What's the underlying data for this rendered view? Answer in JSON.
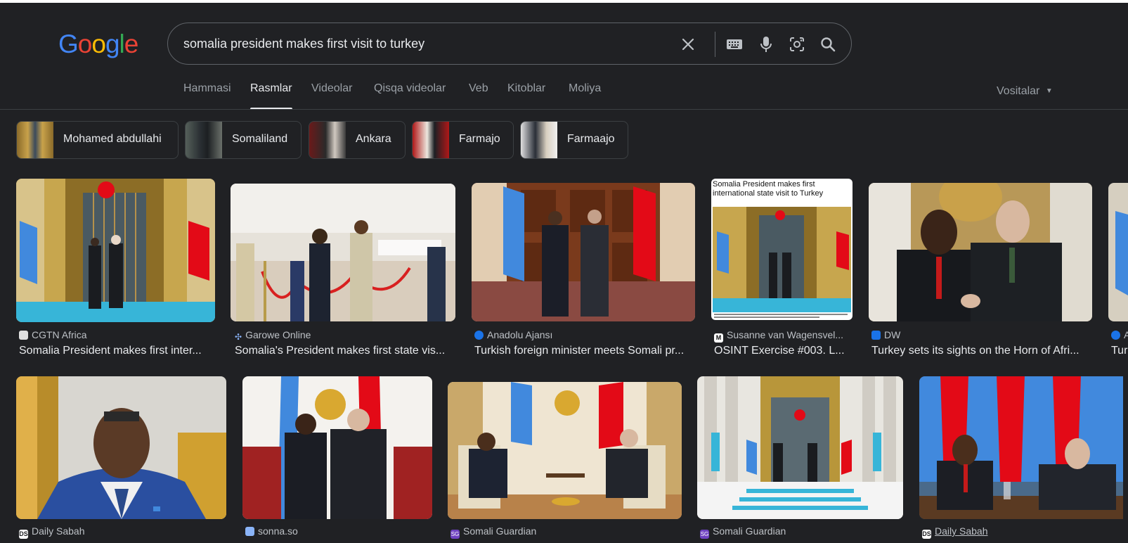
{
  "search": {
    "query": "somalia president makes first visit to turkey"
  },
  "logo": {
    "letters": [
      "G",
      "o",
      "o",
      "g",
      "l",
      "e"
    ],
    "colors": [
      "#4285f4",
      "#ea4335",
      "#fbbc05",
      "#4285f4",
      "#34a853",
      "#ea4335"
    ]
  },
  "icons": {
    "clear": "close-icon",
    "keyboard": "keyboard-icon",
    "voice": "microphone-icon",
    "lens": "camera-icon",
    "search": "search-icon"
  },
  "tabs": [
    {
      "label": "Hammasi"
    },
    {
      "label": "Rasmlar"
    },
    {
      "label": "Videolar"
    },
    {
      "label": "Qisqa videolar"
    },
    {
      "label": "Veb"
    },
    {
      "label": "Kitoblar"
    },
    {
      "label": "Moliya"
    }
  ],
  "active_tab": "Rasmlar",
  "tools_label": "Vositalar",
  "chips": [
    {
      "label": "Mohamed abdullahi"
    },
    {
      "label": "Somaliland"
    },
    {
      "label": "Ankara"
    },
    {
      "label": "Farmajo"
    },
    {
      "label": "Farmaajo"
    }
  ],
  "row1": [
    {
      "source": "CGTN Africa",
      "title": "Somalia President makes first inter..."
    },
    {
      "source": "Garowe Online",
      "title": "Somalia's President makes first state vis..."
    },
    {
      "source": "Anadolu Ajansı",
      "title": "Turkish foreign minister meets Somali pr..."
    },
    {
      "source": "Susanne van Wagensvel...",
      "title": "OSINT Exercise #003. L...",
      "inner_heading": "Somalia President makes first international state visit to Turkey"
    },
    {
      "source": "DW",
      "title": "Turkey sets its sights on the Horn of Afri..."
    },
    {
      "source": "A",
      "title": "Tur"
    }
  ],
  "row2": [
    {
      "source": "Daily Sabah"
    },
    {
      "source": "sonna.so"
    },
    {
      "source": "Somali Guardian"
    },
    {
      "source": "Somali Guardian"
    },
    {
      "source": "Daily Sabah"
    }
  ],
  "colors": {
    "background": "#202124",
    "text": "#e8eaed",
    "muted": "#9aa0a6",
    "border": "#3c4043",
    "somalia_blue": "#4189dd",
    "turkey_red": "#e30a17"
  }
}
